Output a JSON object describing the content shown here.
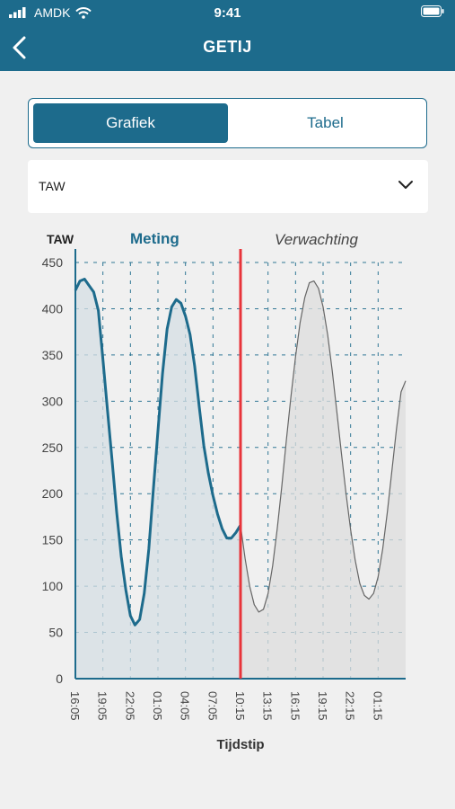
{
  "status_bar": {
    "carrier": "AMDK",
    "time": "9:41"
  },
  "nav": {
    "title": "GETIJ",
    "back_icon": "chevron-left-icon"
  },
  "segmented": {
    "options": [
      "Grafiek",
      "Tabel"
    ],
    "selected": "Grafiek"
  },
  "dropdown": {
    "value": "TAW",
    "icon": "chevron-down-icon"
  },
  "colors": {
    "primary": "#1d6b8c",
    "now_line": "#e8343a",
    "forecast_line": "#666666",
    "fill": "#dfe4e7"
  },
  "chart_data": {
    "type": "line",
    "ylabel": "TAW",
    "xlabel": "Tijdstip",
    "ylim": [
      0,
      450
    ],
    "yticks": [
      0,
      50,
      100,
      150,
      200,
      250,
      300,
      350,
      400,
      450
    ],
    "xticks": [
      "16:05",
      "19:05",
      "22:05",
      "01:05",
      "04:05",
      "07:05",
      "10:15",
      "13:15",
      "16:15",
      "19:15",
      "22:15",
      "01:15"
    ],
    "grid": true,
    "now_x": 18.0,
    "series": [
      {
        "name": "Meting",
        "x": [
          0,
          0.5,
          1,
          1.5,
          2,
          2.5,
          3,
          3.5,
          4,
          4.5,
          5,
          5.5,
          6,
          6.5,
          7,
          7.5,
          8,
          8.5,
          9,
          9.5,
          10,
          10.5,
          11,
          11.5,
          12,
          12.5,
          13,
          13.5,
          14,
          14.5,
          15,
          15.5,
          16,
          16.5,
          17,
          17.5,
          18
        ],
        "y": [
          420,
          430,
          432,
          425,
          418,
          398,
          345,
          290,
          236,
          180,
          132,
          96,
          68,
          58,
          64,
          92,
          140,
          205,
          268,
          330,
          378,
          402,
          410,
          406,
          392,
          372,
          338,
          294,
          252,
          222,
          198,
          178,
          162,
          152,
          152,
          158,
          166
        ]
      },
      {
        "name": "Verwachting",
        "x": [
          18,
          18.5,
          19,
          19.5,
          20,
          20.5,
          21,
          21.5,
          22,
          22.5,
          23,
          23.5,
          24,
          24.5,
          25,
          25.5,
          26,
          26.5,
          27,
          27.5,
          28,
          28.5,
          29,
          29.5,
          30,
          30.5,
          31,
          31.5,
          32,
          32.5,
          33,
          33.5,
          34,
          34.5,
          35,
          35.5,
          36
        ],
        "y": [
          166,
          130,
          100,
          80,
          72,
          75,
          92,
          122,
          162,
          208,
          258,
          305,
          348,
          385,
          412,
          428,
          430,
          422,
          402,
          372,
          333,
          289,
          244,
          200,
          161,
          128,
          103,
          90,
          86,
          92,
          110,
          140,
          180,
          225,
          270,
          310,
          322
        ]
      }
    ]
  }
}
